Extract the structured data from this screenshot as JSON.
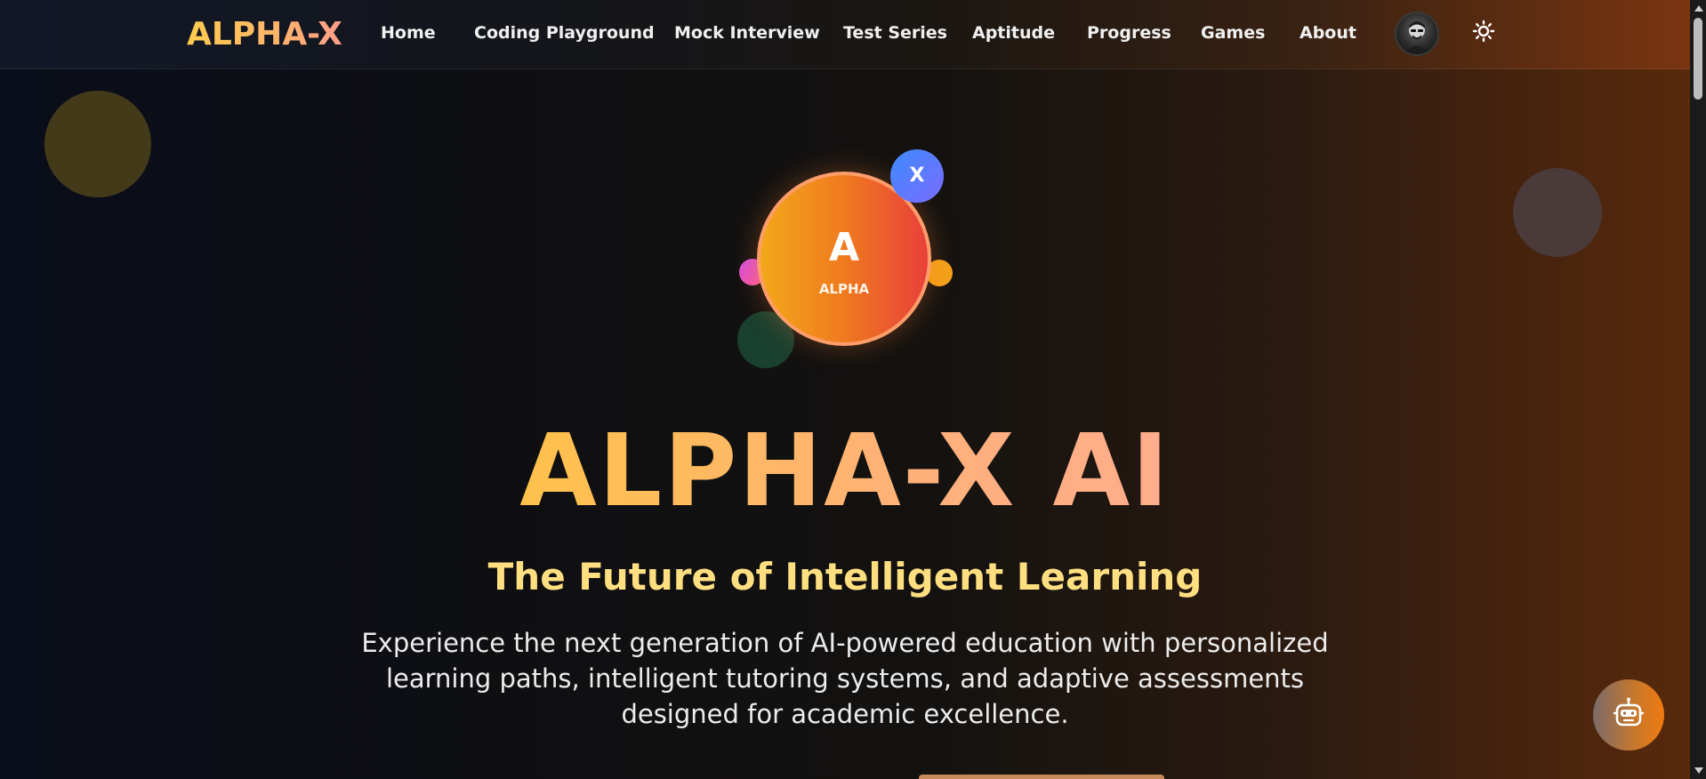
{
  "navbar": {
    "logo": "ALPHA-X",
    "links": [
      {
        "label": "Home"
      },
      {
        "label": "Coding Playground"
      },
      {
        "label": "Mock Interview"
      },
      {
        "label": "Test Series"
      },
      {
        "label": "Aptitude"
      },
      {
        "label": "Progress"
      },
      {
        "label": "Games"
      },
      {
        "label": "About"
      }
    ],
    "avatar_icon": "user-avatar",
    "theme_toggle_icon": "sun-icon"
  },
  "emblem": {
    "letter": "A",
    "word": "ALPHA",
    "badge": "X"
  },
  "hero": {
    "title": "ALPHA-X AI",
    "subtitle": "The Future of Intelligent Learning",
    "description": "Experience the next generation of AI-powered education with personalized learning paths, intelligent tutoring systems, and adaptive assessments designed for academic excellence."
  },
  "chatbot": {
    "icon": "robot-icon"
  },
  "colors": {
    "accent_yellow": "#ffc24a",
    "accent_orange": "#f07a1f",
    "accent_red": "#e8403a",
    "badge_blue": "#3d8bff",
    "subtitle_color": "#ffdf80"
  }
}
